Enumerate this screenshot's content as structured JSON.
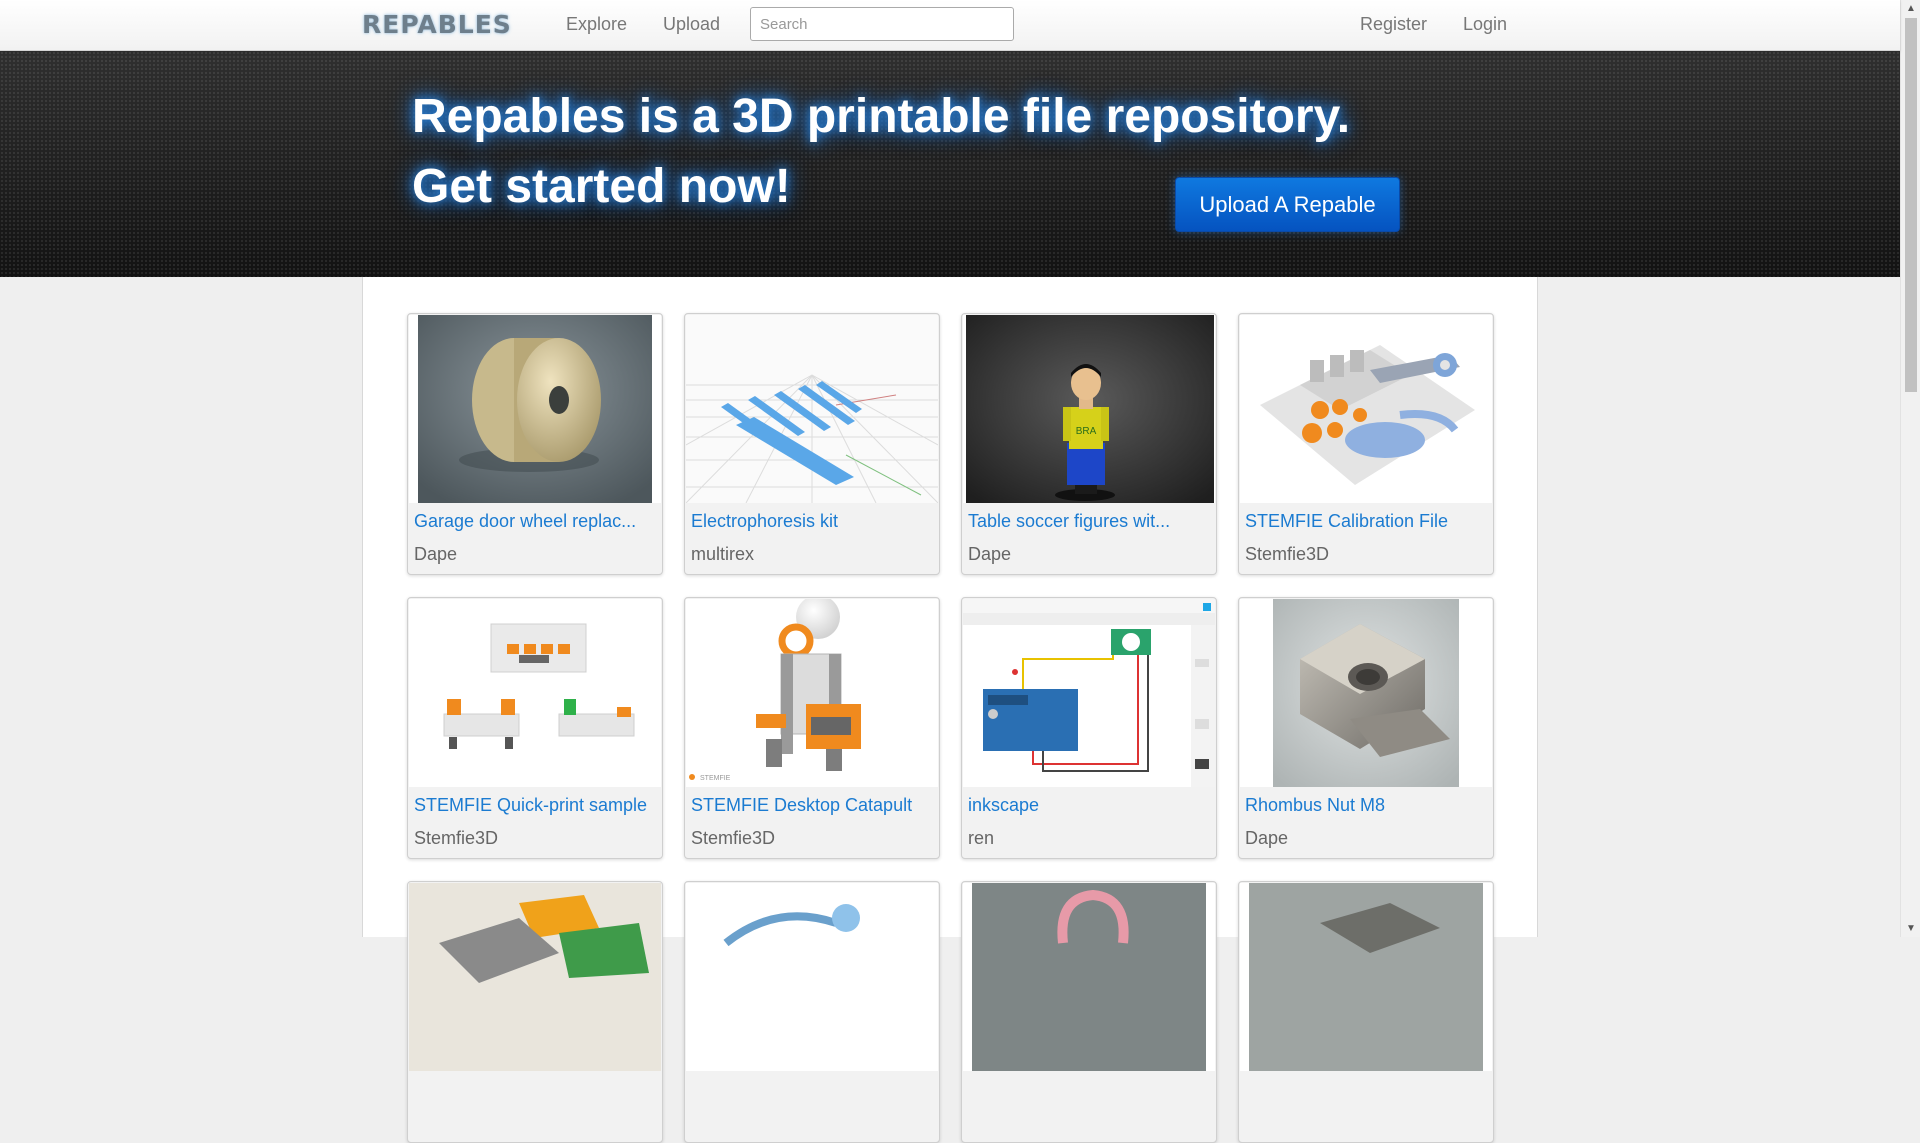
{
  "nav": {
    "brand": "REPABLES",
    "links": [
      "Explore",
      "Upload"
    ],
    "search_placeholder": "Search",
    "auth": [
      "Register",
      "Login"
    ]
  },
  "hero": {
    "line1": "Repables is a 3D printable file repository.",
    "line2": "Get started now!",
    "cta": "Upload A Repable"
  },
  "cards": [
    {
      "title": "Garage door wheel replac...",
      "author": "Dape"
    },
    {
      "title": "Electrophoresis kit",
      "author": "multirex"
    },
    {
      "title": "Table soccer figures wit...",
      "author": "Dape"
    },
    {
      "title": "STEMFIE Calibration File",
      "author": "Stemfie3D"
    },
    {
      "title": "STEMFIE Quick-print sample",
      "author": "Stemfie3D"
    },
    {
      "title": "STEMFIE Desktop Catapult",
      "author": "Stemfie3D"
    },
    {
      "title": "inkscape",
      "author": "ren"
    },
    {
      "title": "Rhombus Nut M8",
      "author": "Dape"
    },
    {
      "title": "",
      "author": ""
    },
    {
      "title": "",
      "author": ""
    },
    {
      "title": "",
      "author": ""
    },
    {
      "title": "",
      "author": ""
    }
  ],
  "thumb_labels": {
    "jersey": "BRA",
    "stemfie": "STEMFIE"
  },
  "colors": {
    "link": "#1b7bd1",
    "cta": "#0a63cf",
    "hero_glow": "#2a7fd4"
  }
}
